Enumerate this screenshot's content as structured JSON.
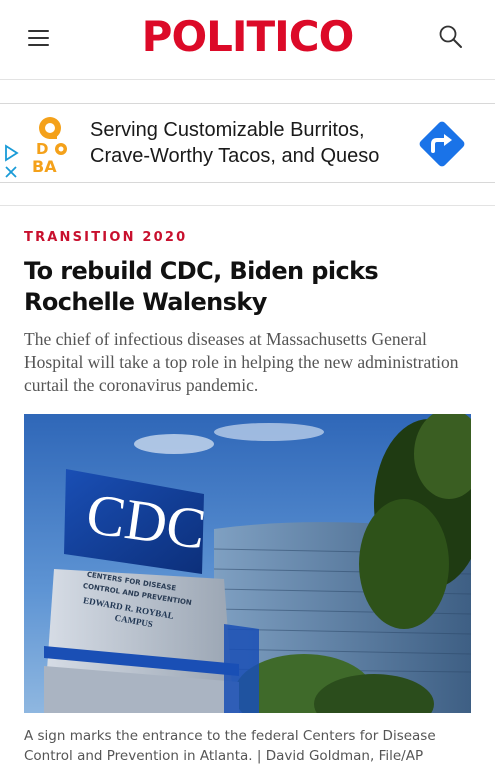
{
  "header": {
    "logo_text": "POLITICO",
    "menu_icon": "hamburger-menu-icon",
    "search_icon": "search-icon",
    "brand_color": "#dc0a28"
  },
  "ad": {
    "brand_logo_text": "QDOBA",
    "text_line1": "Serving Customizable Burritos,",
    "text_line2": "Crave-Worthy Tacos, and Queso",
    "cta_icon": "directions-arrow-icon",
    "cta_color": "#1a73e8",
    "choices_icon": "adchoices-icon",
    "close_icon": "close-icon"
  },
  "article": {
    "kicker": "TRANSITION 2020",
    "headline": "To rebuild CDC, Biden picks Rochelle Walensky",
    "dek": "The chief of infectious diseases at Massachusetts General Hospital will take a top role in helping the new administration curtail the coronavirus pandemic.",
    "photo": {
      "sign_text": "CDC",
      "sign_subtext_1": "CENTERS FOR DISEASE",
      "sign_subtext_2": "CONTROL AND PREVENTION",
      "sign_subtext_3": "EDWARD R. ROYBAL",
      "sign_subtext_4": "CAMPUS"
    },
    "caption": "A sign marks the entrance to the federal Centers for Disease Control and Prevention in Atlanta. | David Goldman, File/AP",
    "kicker_color": "#c8102e"
  }
}
